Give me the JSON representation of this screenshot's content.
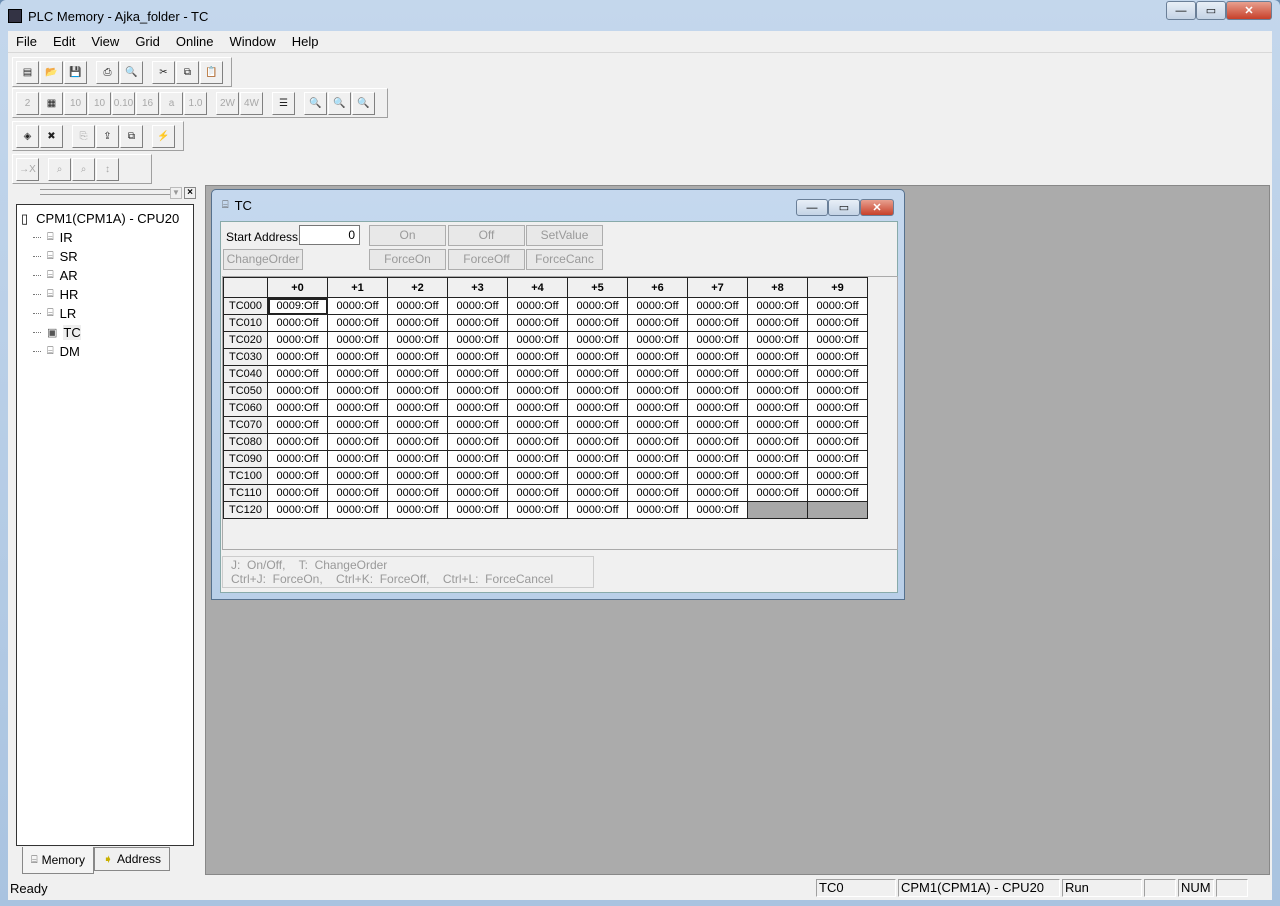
{
  "app": {
    "title": "PLC Memory - Ajka_folder - TC"
  },
  "menu": [
    "File",
    "Edit",
    "View",
    "Grid",
    "Online",
    "Window",
    "Help"
  ],
  "toolbars": [
    [
      {
        "n": "new-icon",
        "g": "▤"
      },
      {
        "n": "open-icon",
        "g": "📂"
      },
      {
        "n": "save-icon",
        "g": "💾"
      },
      {
        "n": "print-icon",
        "g": "⎙",
        "gap": 1
      },
      {
        "n": "print-preview-icon",
        "g": "🔍"
      },
      {
        "n": "cut-icon",
        "g": "✂",
        "gap": 1
      },
      {
        "n": "copy-icon",
        "g": "⧉"
      },
      {
        "n": "paste-icon",
        "g": "📋",
        "dis": 1
      }
    ],
    [
      {
        "n": "binary-icon",
        "g": "2",
        "dis": 1
      },
      {
        "n": "bit-display-icon",
        "g": "▦"
      },
      {
        "n": "decimal-icon",
        "g": "10",
        "dis": 1
      },
      {
        "n": "signed-decimal-icon",
        "g": "10",
        "dis": 1
      },
      {
        "n": "bcd-icon",
        "g": "0.10",
        "dis": 1
      },
      {
        "n": "hex-icon",
        "g": "16",
        "dis": 1
      },
      {
        "n": "ascii-icon",
        "g": "a",
        "dis": 1
      },
      {
        "n": "float-icon",
        "g": "1.0",
        "dis": 1
      },
      {
        "n": "two-word-icon",
        "g": "2W",
        "dis": 1,
        "gap": 1
      },
      {
        "n": "four-word-icon",
        "g": "4W",
        "dis": 1
      },
      {
        "n": "column-width-icon",
        "g": "☰",
        "gap": 1
      },
      {
        "n": "zoom-small-icon",
        "g": "🔍",
        "gap": 1
      },
      {
        "n": "zoom-fit-icon",
        "g": "🔍"
      },
      {
        "n": "zoom-large-icon",
        "g": "🔍"
      }
    ],
    [
      {
        "n": "fill-icon",
        "g": "◈"
      },
      {
        "n": "clear-icon",
        "g": "✖"
      },
      {
        "n": "transfer-from-icon",
        "g": "⎘",
        "dis": 1,
        "gap": 1
      },
      {
        "n": "transfer-to-icon",
        "g": "⇪"
      },
      {
        "n": "compare-icon",
        "g": "⧉"
      },
      {
        "n": "monitor-icon",
        "g": "⚡",
        "gap": 1
      }
    ],
    [
      {
        "n": "cancel-force-icon",
        "g": "→X",
        "dis": 1
      },
      {
        "n": "address-find-icon",
        "g": "⌕",
        "dis": 1,
        "gap": 1
      },
      {
        "n": "address-next-icon",
        "g": "⌕",
        "dis": 1
      },
      {
        "n": "address-list-icon",
        "g": "↕",
        "dis": 1
      }
    ]
  ],
  "tree": {
    "root": "CPM1(CPM1A) - CPU20",
    "items": [
      "IR",
      "SR",
      "AR",
      "HR",
      "LR",
      "TC",
      "DM"
    ],
    "selected": "TC"
  },
  "leftTabs": [
    "Memory",
    "Address"
  ],
  "child": {
    "title": "TC",
    "start_label": "Start Address:",
    "start_value": "0",
    "buttons": {
      "on": "On",
      "off": "Off",
      "setvalue": "SetValue",
      "changeorder": "ChangeOrder",
      "forceon": "ForceOn",
      "forceoff": "ForceOff",
      "forcecanc": "ForceCanc"
    },
    "columns": [
      "+0",
      "+1",
      "+2",
      "+3",
      "+4",
      "+5",
      "+6",
      "+7",
      "+8",
      "+9"
    ],
    "rows": [
      {
        "addr": "TC000",
        "values": [
          "0009:Off",
          "0000:Off",
          "0000:Off",
          "0000:Off",
          "0000:Off",
          "0000:Off",
          "0000:Off",
          "0000:Off",
          "0000:Off",
          "0000:Off"
        ]
      },
      {
        "addr": "TC010",
        "values": [
          "0000:Off",
          "0000:Off",
          "0000:Off",
          "0000:Off",
          "0000:Off",
          "0000:Off",
          "0000:Off",
          "0000:Off",
          "0000:Off",
          "0000:Off"
        ]
      },
      {
        "addr": "TC020",
        "values": [
          "0000:Off",
          "0000:Off",
          "0000:Off",
          "0000:Off",
          "0000:Off",
          "0000:Off",
          "0000:Off",
          "0000:Off",
          "0000:Off",
          "0000:Off"
        ]
      },
      {
        "addr": "TC030",
        "values": [
          "0000:Off",
          "0000:Off",
          "0000:Off",
          "0000:Off",
          "0000:Off",
          "0000:Off",
          "0000:Off",
          "0000:Off",
          "0000:Off",
          "0000:Off"
        ]
      },
      {
        "addr": "TC040",
        "values": [
          "0000:Off",
          "0000:Off",
          "0000:Off",
          "0000:Off",
          "0000:Off",
          "0000:Off",
          "0000:Off",
          "0000:Off",
          "0000:Off",
          "0000:Off"
        ]
      },
      {
        "addr": "TC050",
        "values": [
          "0000:Off",
          "0000:Off",
          "0000:Off",
          "0000:Off",
          "0000:Off",
          "0000:Off",
          "0000:Off",
          "0000:Off",
          "0000:Off",
          "0000:Off"
        ]
      },
      {
        "addr": "TC060",
        "values": [
          "0000:Off",
          "0000:Off",
          "0000:Off",
          "0000:Off",
          "0000:Off",
          "0000:Off",
          "0000:Off",
          "0000:Off",
          "0000:Off",
          "0000:Off"
        ]
      },
      {
        "addr": "TC070",
        "values": [
          "0000:Off",
          "0000:Off",
          "0000:Off",
          "0000:Off",
          "0000:Off",
          "0000:Off",
          "0000:Off",
          "0000:Off",
          "0000:Off",
          "0000:Off"
        ]
      },
      {
        "addr": "TC080",
        "values": [
          "0000:Off",
          "0000:Off",
          "0000:Off",
          "0000:Off",
          "0000:Off",
          "0000:Off",
          "0000:Off",
          "0000:Off",
          "0000:Off",
          "0000:Off"
        ]
      },
      {
        "addr": "TC090",
        "values": [
          "0000:Off",
          "0000:Off",
          "0000:Off",
          "0000:Off",
          "0000:Off",
          "0000:Off",
          "0000:Off",
          "0000:Off",
          "0000:Off",
          "0000:Off"
        ]
      },
      {
        "addr": "TC100",
        "values": [
          "0000:Off",
          "0000:Off",
          "0000:Off",
          "0000:Off",
          "0000:Off",
          "0000:Off",
          "0000:Off",
          "0000:Off",
          "0000:Off",
          "0000:Off"
        ]
      },
      {
        "addr": "TC110",
        "values": [
          "0000:Off",
          "0000:Off",
          "0000:Off",
          "0000:Off",
          "0000:Off",
          "0000:Off",
          "0000:Off",
          "0000:Off",
          "0000:Off",
          "0000:Off"
        ]
      },
      {
        "addr": "TC120",
        "values": [
          "0000:Off",
          "0000:Off",
          "0000:Off",
          "0000:Off",
          "0000:Off",
          "0000:Off",
          "0000:Off",
          "0000:Off"
        ]
      }
    ],
    "hint1": "J:  On/Off,    T:  ChangeOrder",
    "hint2": "Ctrl+J:  ForceOn,    Ctrl+K:  ForceOff,    Ctrl+L:  ForceCancel"
  },
  "status": {
    "text": "Ready",
    "address": "TC0",
    "plc": "CPM1(CPM1A) - CPU20",
    "mode": "Run",
    "blank": "",
    "num": "NUM"
  }
}
